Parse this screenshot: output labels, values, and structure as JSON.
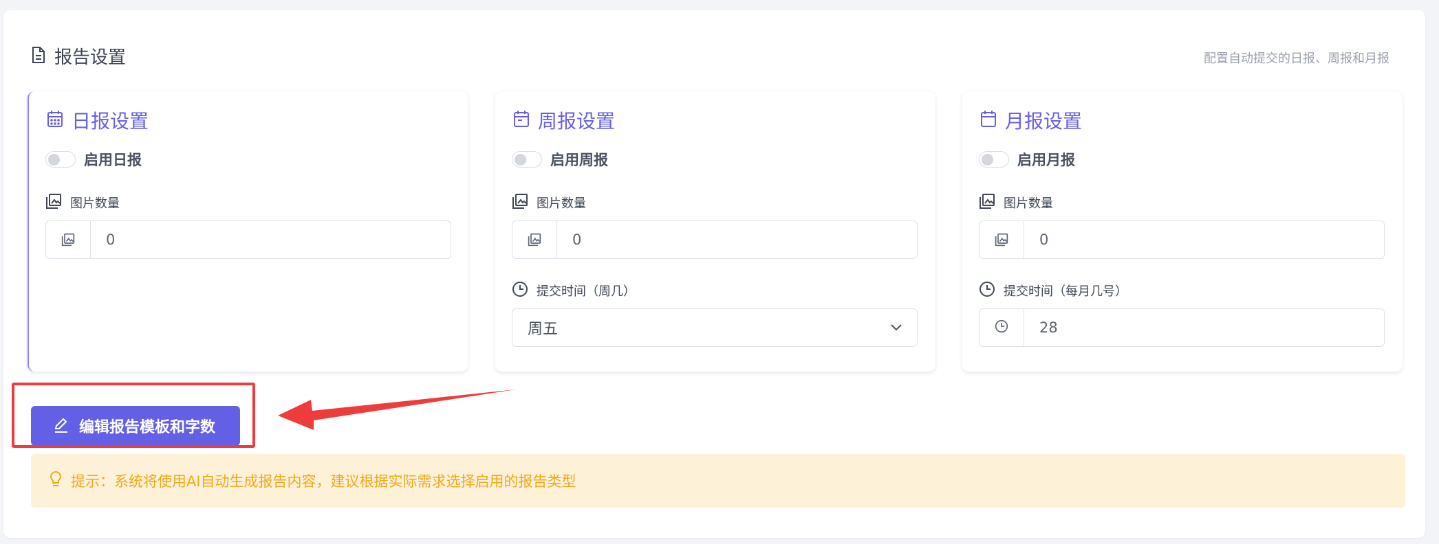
{
  "header": {
    "title": "报告设置",
    "description": "配置自动提交的日报、周报和月报"
  },
  "daily": {
    "title": "日报设置",
    "toggle_label": "启用日报",
    "enabled": false,
    "image_count_label": "图片数量",
    "image_count_value": "0"
  },
  "weekly": {
    "title": "周报设置",
    "toggle_label": "启用周报",
    "enabled": false,
    "image_count_label": "图片数量",
    "image_count_value": "0",
    "submit_label": "提交时间（周几）",
    "submit_value": "周五"
  },
  "monthly": {
    "title": "月报设置",
    "toggle_label": "启用月报",
    "enabled": false,
    "image_count_label": "图片数量",
    "image_count_value": "0",
    "submit_label": "提交时间（每月几号）",
    "submit_value": "28"
  },
  "actions": {
    "edit_template_label": "编辑报告模板和字数"
  },
  "tip": {
    "text": "提示：系统将使用AI自动生成报告内容，建议根据实际需求选择启用的报告类型"
  },
  "colors": {
    "accent": "#6360e6",
    "annotation": "#ee3b3b",
    "tip_text": "#f0a81a",
    "tip_bg": "#fdf1d8"
  },
  "icons": {
    "header": "document-icon",
    "card_title": "calendar-icon",
    "image_count": "image-stack-icon",
    "submit_time": "clock-icon",
    "select": "chevron-down-icon",
    "edit": "pencil-icon",
    "tip": "lightbulb-icon"
  }
}
